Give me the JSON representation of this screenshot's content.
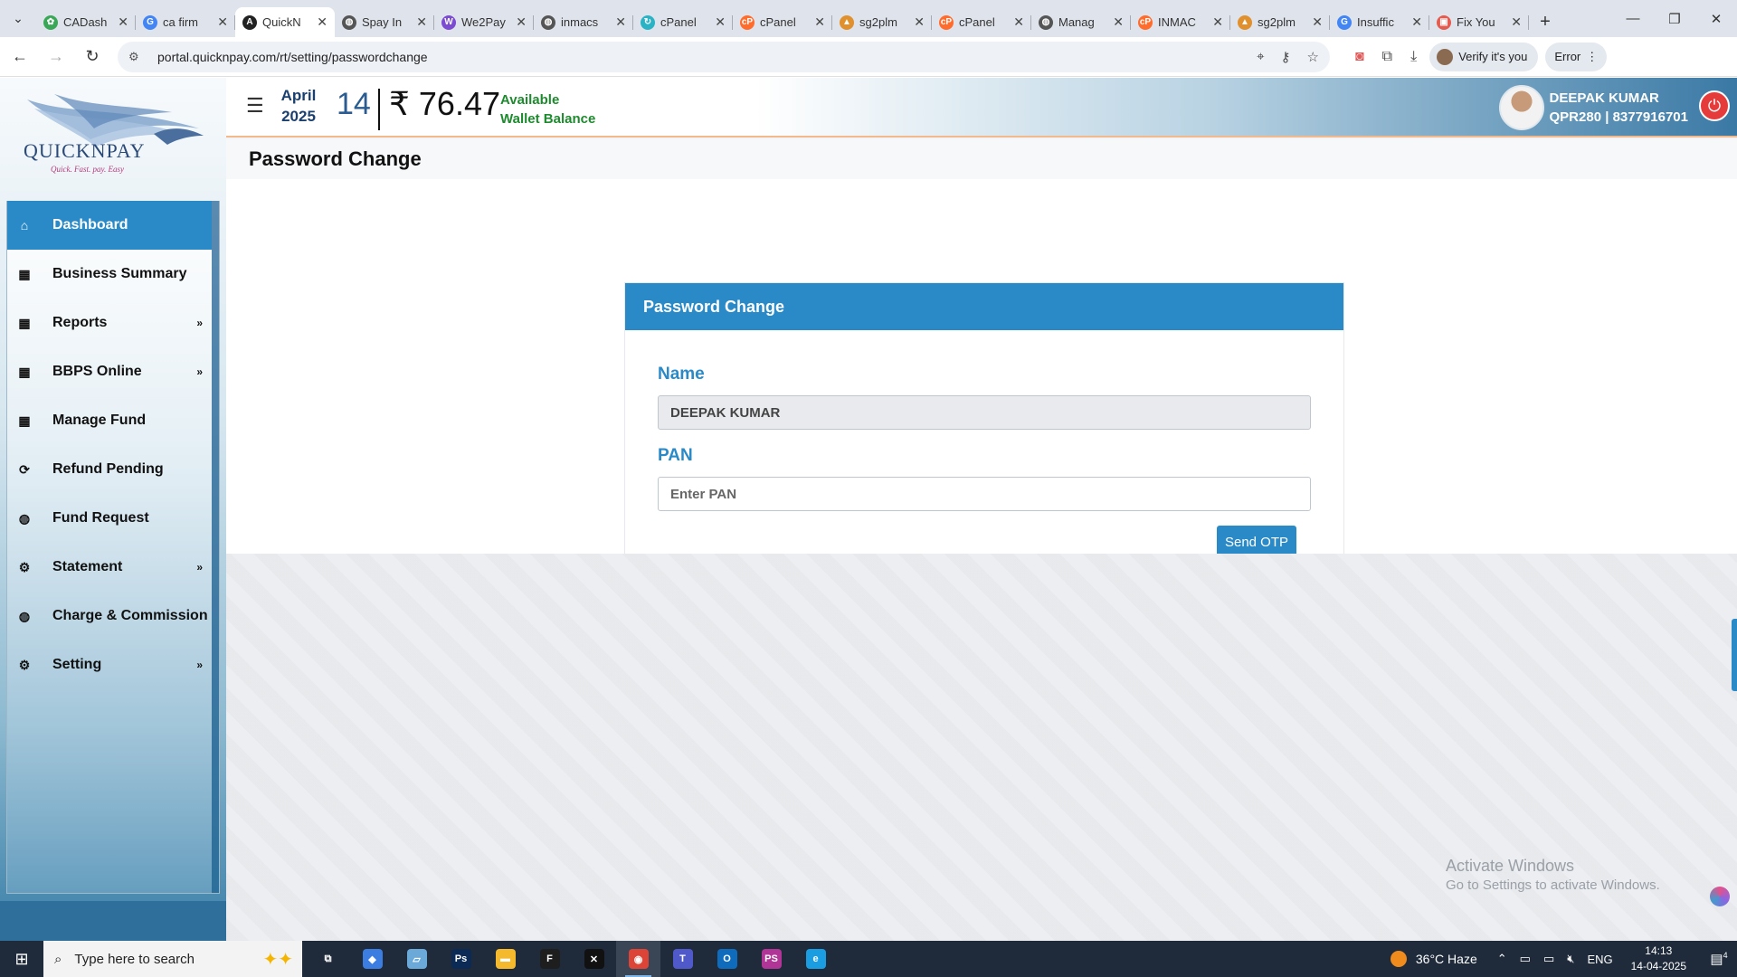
{
  "browser": {
    "tabs": [
      {
        "title": "CADash",
        "color": "#3aa757",
        "glyph": "✿"
      },
      {
        "title": "ca firm",
        "color": "#4285f4",
        "glyph": "G"
      },
      {
        "title": "QuickN",
        "color": "#222222",
        "glyph": "A",
        "active": true
      },
      {
        "title": "Spay In",
        "color": "#555555",
        "glyph": "◍"
      },
      {
        "title": "We2Pay",
        "color": "#7b4bd1",
        "glyph": "W"
      },
      {
        "title": "inmacs",
        "color": "#555555",
        "glyph": "◍"
      },
      {
        "title": "cPanel",
        "color": "#2ab3c5",
        "glyph": "↻"
      },
      {
        "title": "cPanel",
        "color": "#ff6c2c",
        "glyph": "cP"
      },
      {
        "title": "sg2plm",
        "color": "#e0902d",
        "glyph": "▲"
      },
      {
        "title": "cPanel",
        "color": "#ff6c2c",
        "glyph": "cP"
      },
      {
        "title": "Manag",
        "color": "#555555",
        "glyph": "◍"
      },
      {
        "title": "INMAC",
        "color": "#ff6c2c",
        "glyph": "cP"
      },
      {
        "title": "sg2plm",
        "color": "#e0902d",
        "glyph": "▲"
      },
      {
        "title": "Insuffic",
        "color": "#4285f4",
        "glyph": "G"
      },
      {
        "title": "Fix You",
        "color": "#e45b4f",
        "glyph": "▣"
      }
    ],
    "url": "portal.quicknpay.com/rt/setting/passwordchange",
    "verify_label": "Verify it's you",
    "error_label": "Error"
  },
  "logo": {
    "brand": "QUICKNPAY",
    "tagline": "Quick. Fast. pay. Easy"
  },
  "sidebar": {
    "items": [
      {
        "label": "Dashboard",
        "icon": "home-icon",
        "glyph": "⌂",
        "active": true,
        "arrow": false
      },
      {
        "label": "Business Summary",
        "icon": "calendar-icon",
        "glyph": "▦",
        "arrow": false
      },
      {
        "label": "Reports",
        "icon": "calendar-icon",
        "glyph": "▦",
        "arrow": true
      },
      {
        "label": "BBPS Online",
        "icon": "calendar-icon",
        "glyph": "▦",
        "arrow": true
      },
      {
        "label": "Manage Fund",
        "icon": "calendar-icon",
        "glyph": "▦",
        "arrow": false
      },
      {
        "label": "Refund Pending",
        "icon": "refresh-icon",
        "glyph": "⟳",
        "arrow": false
      },
      {
        "label": "Fund Request",
        "icon": "globe-icon",
        "glyph": "◍",
        "arrow": false
      },
      {
        "label": "Statement",
        "icon": "gear-icon",
        "glyph": "⚙",
        "arrow": true
      },
      {
        "label": "Charge & Commission",
        "icon": "globe-icon",
        "glyph": "◍",
        "arrow": false
      },
      {
        "label": "Setting",
        "icon": "gear-icon",
        "glyph": "⚙",
        "arrow": true
      }
    ],
    "arrow_glyph": "»"
  },
  "header": {
    "month": "April",
    "year": "2025",
    "day": "14",
    "balance": "₹ 76.47",
    "available_line1": "Available",
    "available_line2": "Wallet Balance",
    "user_name": "DEEPAK KUMAR",
    "user_meta": "QPR280 | 8377916701"
  },
  "page": {
    "title": "Password Change",
    "card_title": "Password Change",
    "name_label": "Name",
    "name_value": "DEEPAK KUMAR",
    "pan_label": "PAN",
    "pan_placeholder": "Enter PAN",
    "send_otp_label": "Send OTP"
  },
  "watermark": {
    "line1": "Activate Windows",
    "line2": "Go to Settings to activate Windows."
  },
  "taskbar": {
    "search_placeholder": "Type here to search",
    "apps": [
      {
        "name": "task-view",
        "color": "#1f2b3a",
        "glyph": "⧉"
      },
      {
        "name": "copilot",
        "color": "#3b7de0",
        "glyph": "◆"
      },
      {
        "name": "notepad",
        "color": "#6aa9d8",
        "glyph": "▱"
      },
      {
        "name": "photoshop",
        "color": "#0b2a55",
        "glyph": "Ps"
      },
      {
        "name": "file-explorer",
        "color": "#f5b92e",
        "glyph": "▬"
      },
      {
        "name": "figma",
        "color": "#1e1e1e",
        "glyph": "F"
      },
      {
        "name": "capcut",
        "color": "#111111",
        "glyph": "✕"
      },
      {
        "name": "chrome",
        "color": "#db4437",
        "glyph": "◉",
        "active": true
      },
      {
        "name": "teams",
        "color": "#5059c9",
        "glyph": "T"
      },
      {
        "name": "outlook",
        "color": "#0f6cbd",
        "glyph": "O"
      },
      {
        "name": "phpstorm",
        "color": "#b03596",
        "glyph": "PS"
      },
      {
        "name": "edge",
        "color": "#1b9de2",
        "glyph": "e"
      }
    ],
    "weather": "36°C  Haze",
    "lang": "ENG",
    "time": "14:13",
    "date": "14-04-2025",
    "notif_count": "4"
  }
}
